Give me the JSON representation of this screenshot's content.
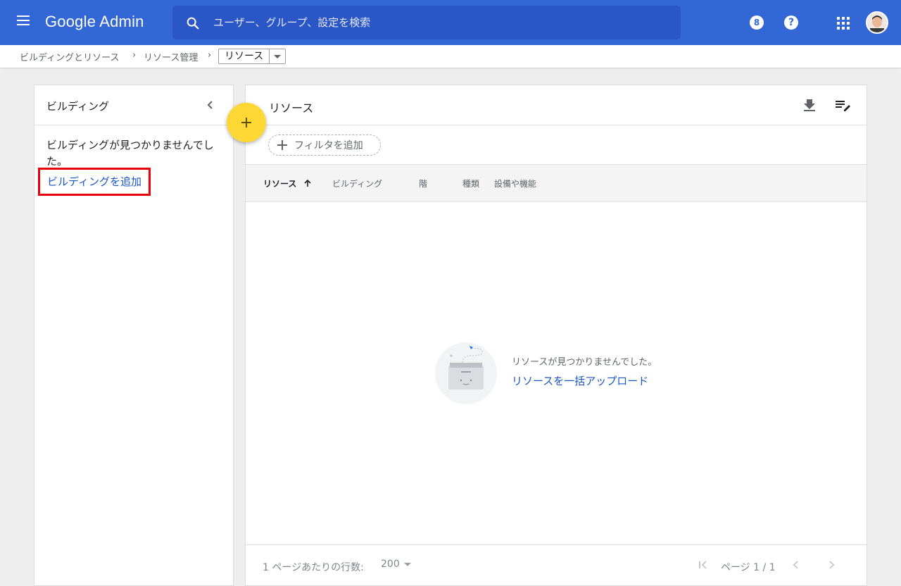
{
  "header": {
    "app_name": "Google Admin",
    "search_placeholder": "ユーザー、グループ、設定を検索",
    "badge_number": "8",
    "help_glyph": "?"
  },
  "breadcrumb": {
    "items": [
      "ビルディングとリソース",
      "リソース管理"
    ],
    "separator": "›",
    "current": "リソース"
  },
  "buildings_panel": {
    "title": "ビルディング",
    "empty_message": "ビルディングが見つかりませんでした。",
    "add_link": "ビルディングを追加"
  },
  "resources_panel": {
    "title": "リソース",
    "filter_chip": "フィルタを追加",
    "columns": [
      "リソース",
      "ビルディング",
      "階",
      "種類",
      "設備や機能"
    ],
    "sorted_column": "リソース",
    "sort_direction": "ascending",
    "empty_message": "リソースが見つかりませんでした。",
    "bulk_upload_link": "リソースを一括アップロード",
    "footer": {
      "rows_per_page_label": "1 ページあたりの行数:",
      "rows_per_page_value": "200",
      "page_label": "ページ 1 / 1"
    }
  },
  "colors": {
    "header_bg": "#3367d6",
    "search_bg": "#2a56c6",
    "fab": "#fdd835",
    "link": "#1a56c6",
    "highlight_border": "#e8000b"
  },
  "icons": [
    "menu-icon",
    "search-icon",
    "notifications-badge-icon",
    "help-icon",
    "apps-grid-icon",
    "chevron-left-icon",
    "add-icon",
    "download-icon",
    "edit-columns-icon",
    "arrow-up-icon",
    "first-page-icon",
    "chevron-left-icon",
    "chevron-right-icon"
  ]
}
